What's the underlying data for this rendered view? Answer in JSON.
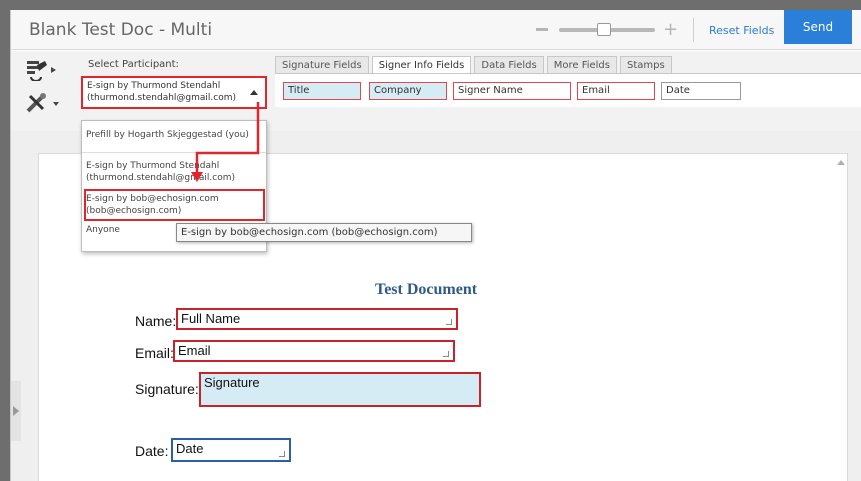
{
  "window": {
    "title": "Blank Test Doc - Multi",
    "reset_label": "Reset Fields",
    "send_label": "Send",
    "zoom_minus": "—",
    "zoom_plus": "+"
  },
  "toolbar": {
    "select_label": "Select Participant:",
    "selected_participant_line1": "E-sign by Thurmond Stendahl",
    "selected_participant_line2": "(thurmond.stendahl@gmail.com)",
    "tabs": [
      {
        "label": "Signature Fields"
      },
      {
        "label": "Signer Info Fields"
      },
      {
        "label": "Data Fields"
      },
      {
        "label": "More Fields"
      },
      {
        "label": "Stamps"
      }
    ],
    "active_tab": "Signer Info Fields",
    "chips": [
      {
        "label": "Title"
      },
      {
        "label": "Company"
      },
      {
        "label": "Signer Name"
      },
      {
        "label": "Email"
      },
      {
        "label": "Date"
      }
    ]
  },
  "dropdown": {
    "items": [
      {
        "line1": "Prefill by Hogarth Skjeggestad (you)",
        "line2": ""
      },
      {
        "line1": "E-sign by Thurmond Stendahl",
        "line2": "(thurmond.stendahl@gmail.com)"
      },
      {
        "line1": "E-sign by bob@echosign.com",
        "line2": "(bob@echosign.com)"
      },
      {
        "line1": "Anyone",
        "line2": ""
      }
    ],
    "tooltip": "E-sign by bob@echosign.com (bob@echosign.com)"
  },
  "document": {
    "heading": "Test Document",
    "fields": [
      {
        "label": "Name:",
        "value": "Full Name"
      },
      {
        "label": "Email:",
        "value": "Email"
      },
      {
        "label": "Signature:",
        "value": "Signature"
      },
      {
        "label": "Date:",
        "value": "Date"
      }
    ]
  },
  "colors": {
    "accent": "#2a7fd9",
    "highlight": "#e0252c",
    "signature_fill": "#d6ecf5",
    "heading": "#2e5a8a"
  }
}
